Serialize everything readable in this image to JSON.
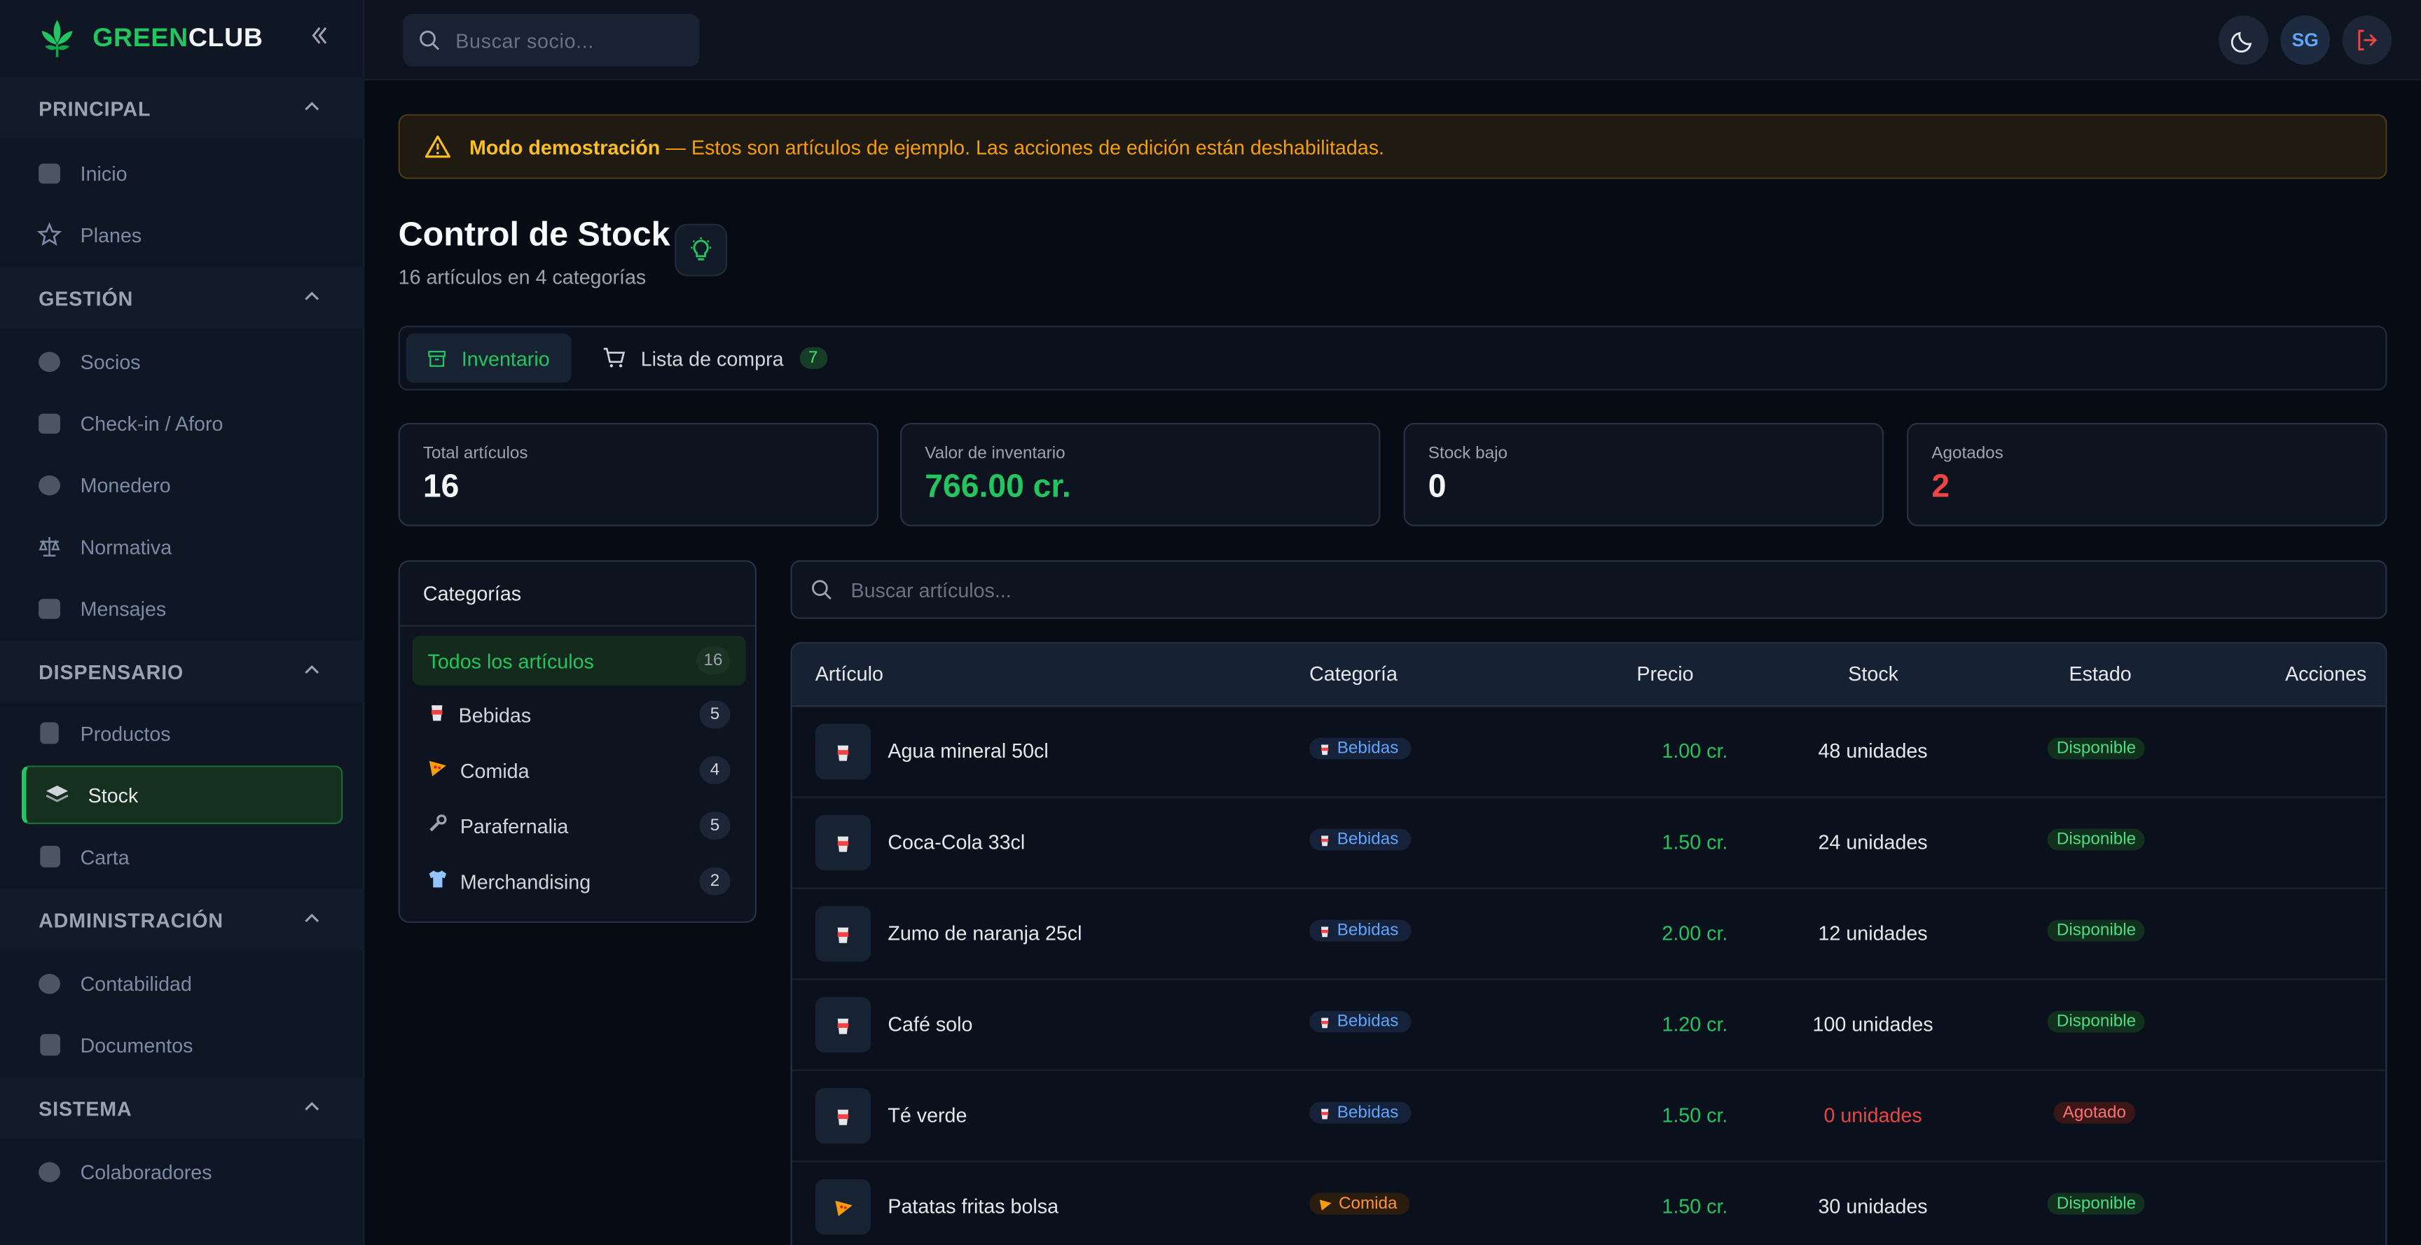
{
  "brand": {
    "part1": "GREEN",
    "part2": "CLUB"
  },
  "topbar": {
    "search_placeholder": "Buscar socio...",
    "avatar_initials": "SG"
  },
  "sidebar": {
    "sections": [
      {
        "title": "PRINCIPAL",
        "items": [
          "Inicio",
          "Planes"
        ]
      },
      {
        "title": "GESTIÓN",
        "items": [
          "Socios",
          "Check-in / Aforo",
          "Monedero",
          "Normativa",
          "Mensajes"
        ]
      },
      {
        "title": "DISPENSARIO",
        "items": [
          "Productos",
          "Stock",
          "Carta"
        ]
      },
      {
        "title": "ADMINISTRACIÓN",
        "items": [
          "Contabilidad",
          "Documentos"
        ]
      },
      {
        "title": "SISTEMA",
        "items": [
          "Colaboradores"
        ]
      }
    ],
    "active_item": "Stock"
  },
  "banner": {
    "bold": "Modo demostración",
    "message": " — Estos son artículos de ejemplo. Las acciones de edición están deshabilitadas."
  },
  "page": {
    "title": "Control de Stock",
    "subtitle": "16 artículos en 4 categorías"
  },
  "tabs": [
    {
      "label": "Inventario",
      "icon": "archive-icon"
    },
    {
      "label": "Lista de compra",
      "icon": "cart-icon",
      "badge": "7"
    }
  ],
  "stats": [
    {
      "label": "Total artículos",
      "value": "16",
      "color": "#f3f4f6"
    },
    {
      "label": "Valor de inventario",
      "value": "766.00 cr.",
      "color": "#22c55e"
    },
    {
      "label": "Stock bajo",
      "value": "0",
      "color": "#f3f4f6"
    },
    {
      "label": "Agotados",
      "value": "2",
      "color": "#ef4444"
    }
  ],
  "categories": {
    "title": "Categorías",
    "items": [
      {
        "label": "Todos los artículos",
        "count": "16",
        "icon": ""
      },
      {
        "label": "Bebidas",
        "count": "5",
        "icon": "cup-icon"
      },
      {
        "label": "Comida",
        "count": "4",
        "icon": "pizza-icon"
      },
      {
        "label": "Parafernalia",
        "count": "5",
        "icon": "wrench-icon"
      },
      {
        "label": "Merchandising",
        "count": "2",
        "icon": "shirt-icon"
      }
    ]
  },
  "items_search": {
    "placeholder": "Buscar artículos..."
  },
  "table": {
    "headers": [
      "Artículo",
      "Categoría",
      "Precio",
      "Stock",
      "Estado",
      "Acciones"
    ],
    "rows": [
      {
        "name": "Agua mineral 50cl",
        "category": "Bebidas",
        "price": "1.00 cr.",
        "stock": "48 unidades",
        "status": "Disponible"
      },
      {
        "name": "Coca-Cola 33cl",
        "category": "Bebidas",
        "price": "1.50 cr.",
        "stock": "24 unidades",
        "status": "Disponible"
      },
      {
        "name": "Zumo de naranja 25cl",
        "category": "Bebidas",
        "price": "2.00 cr.",
        "stock": "12 unidades",
        "status": "Disponible"
      },
      {
        "name": "Café solo",
        "category": "Bebidas",
        "price": "1.20 cr.",
        "stock": "100 unidades",
        "status": "Disponible"
      },
      {
        "name": "Té verde",
        "category": "Bebidas",
        "price": "1.50 cr.",
        "stock": "0 unidades",
        "status": "Agotado"
      },
      {
        "name": "Patatas fritas bolsa",
        "category": "Comida",
        "price": "1.50 cr.",
        "stock": "30 unidades",
        "status": "Disponible"
      }
    ]
  }
}
